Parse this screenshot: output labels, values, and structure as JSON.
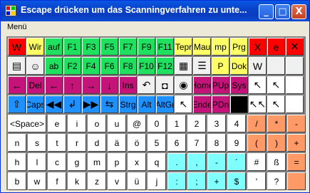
{
  "window": {
    "title": "Escape drücken um das Scanningverfahren zu unte...",
    "min_glyph": "_",
    "max_glyph": "□",
    "close_glyph": "X"
  },
  "menu": {
    "label": "Menü"
  },
  "rows": [
    [
      {
        "t": "",
        "c": "red",
        "icon": "word-icon",
        "g": "W"
      },
      {
        "t": "Wir",
        "c": "yel"
      },
      {
        "t": "auf",
        "c": "grn"
      },
      {
        "t": "F1",
        "c": "grn"
      },
      {
        "t": "F3",
        "c": "grn"
      },
      {
        "t": "F5",
        "c": "grn"
      },
      {
        "t": "F7",
        "c": "grn"
      },
      {
        "t": "F9",
        "c": "grn"
      },
      {
        "t": "F11",
        "c": "grn"
      },
      {
        "t": "Tepr",
        "c": "yel"
      },
      {
        "t": "Mau",
        "c": "yel"
      },
      {
        "t": "mp",
        "c": "yel"
      },
      {
        "t": "Prg",
        "c": "yel"
      },
      {
        "t": "",
        "c": "red",
        "icon": "excel-icon",
        "g": "X"
      },
      {
        "t": "",
        "c": "red",
        "icon": "internet-explorer-icon",
        "g": "e"
      },
      {
        "t": "",
        "c": "red",
        "icon": "close-icon",
        "g": "✕"
      }
    ],
    [
      {
        "t": "",
        "c": "icn",
        "icon": "document-icon",
        "g": "▤"
      },
      {
        "t": "",
        "c": "icn",
        "icon": "contacts-icon",
        "g": "☺"
      },
      {
        "t": "ab",
        "c": "grn"
      },
      {
        "t": "F2",
        "c": "grn"
      },
      {
        "t": "F4",
        "c": "grn"
      },
      {
        "t": "F6",
        "c": "grn"
      },
      {
        "t": "F8",
        "c": "grn"
      },
      {
        "t": "F10",
        "c": "grn"
      },
      {
        "t": "F12",
        "c": "grn"
      },
      {
        "t": "",
        "c": "icn",
        "icon": "keyboard-icon",
        "g": "▦"
      },
      {
        "t": "",
        "c": "icn",
        "icon": "list-icon",
        "g": "☰"
      },
      {
        "t": "P",
        "c": "yel"
      },
      {
        "t": "Dok",
        "c": "yel"
      },
      {
        "t": "",
        "c": "icn",
        "icon": "word-file-icon",
        "g": "W"
      },
      {
        "t": "",
        "c": "icn",
        "icon": "blank-icon",
        "g": ""
      },
      {
        "t": "",
        "c": "icn",
        "icon": "blank-icon",
        "g": ""
      }
    ],
    [
      {
        "t": "",
        "c": "mag",
        "icon": "arrow-left-icon",
        "g": "←"
      },
      {
        "t": "Del",
        "c": "mag"
      },
      {
        "t": "",
        "c": "mag",
        "icon": "arrow-left-icon",
        "g": "←"
      },
      {
        "t": "",
        "c": "mag",
        "icon": "arrow-up-icon",
        "g": "↑"
      },
      {
        "t": "",
        "c": "mag",
        "icon": "arrow-right-icon",
        "g": "→"
      },
      {
        "t": "",
        "c": "mag",
        "icon": "arrow-down-icon",
        "g": "↓"
      },
      {
        "t": "Ins",
        "c": "mag"
      },
      {
        "t": "",
        "c": "icn",
        "icon": "undo-icon",
        "g": "↶"
      },
      {
        "t": "",
        "c": "icn",
        "icon": "camera-icon",
        "g": "◘"
      },
      {
        "t": "",
        "c": "icn",
        "icon": "magnifier-icon",
        "g": "◉"
      },
      {
        "t": "Home",
        "c": "mag"
      },
      {
        "t": "PUp",
        "c": "mag"
      },
      {
        "t": "Sys",
        "c": "mag"
      },
      {
        "t": "",
        "c": "wht",
        "icon": "cursor-icon",
        "g": "↖"
      },
      {
        "t": "",
        "c": "wht",
        "icon": "cursor-icon",
        "g": "↖"
      },
      {
        "t": "",
        "c": "wht",
        "icon": "blank-icon",
        "g": ""
      }
    ],
    [
      {
        "t": "",
        "c": "blu",
        "icon": "shift-icon",
        "g": "⇧"
      },
      {
        "t": "Caps",
        "c": "blu"
      },
      {
        "t": "",
        "c": "blu",
        "icon": "rewind-icon",
        "g": "◀◀"
      },
      {
        "t": "",
        "c": "blu",
        "icon": "arrow-down-return-icon",
        "g": "↲"
      },
      {
        "t": "",
        "c": "blu",
        "icon": "fast-forward-icon",
        "g": "▶▶"
      },
      {
        "t": "",
        "c": "blu",
        "icon": "tab-icon",
        "g": "⇆"
      },
      {
        "t": "Strg",
        "c": "blu"
      },
      {
        "t": "Alt",
        "c": "blu"
      },
      {
        "t": "AltGr",
        "c": "blu"
      },
      {
        "t": "",
        "c": "wht",
        "icon": "cursor-icon",
        "g": "↖"
      },
      {
        "t": "Ende",
        "c": "mag"
      },
      {
        "t": "PDn",
        "c": "mag"
      },
      {
        "t": "",
        "c": "blk",
        "icon": "black-square-icon",
        "g": ""
      },
      {
        "t": "",
        "c": "wht",
        "icon": "double-cursor-icon",
        "g": "↖↖"
      },
      {
        "t": "",
        "c": "wht",
        "icon": "cursor-arrow-icon",
        "g": "↖"
      },
      {
        "t": "",
        "c": "wht",
        "icon": "blank-icon",
        "g": ""
      }
    ],
    [
      {
        "t": "<Space>",
        "c": "wht",
        "w": 2
      },
      {
        "t": "e",
        "c": "wht"
      },
      {
        "t": "i",
        "c": "wht"
      },
      {
        "t": "o",
        "c": "wht"
      },
      {
        "t": "u",
        "c": "wht"
      },
      {
        "t": "@",
        "c": "wht"
      },
      {
        "t": "0",
        "c": "wht"
      },
      {
        "t": "1",
        "c": "wht"
      },
      {
        "t": "2",
        "c": "wht"
      },
      {
        "t": "3",
        "c": "wht"
      },
      {
        "t": "4",
        "c": "wht"
      },
      {
        "t": "/",
        "c": "org"
      },
      {
        "t": "*",
        "c": "org"
      },
      {
        "t": "-",
        "c": "org"
      }
    ],
    [
      {
        "t": "n",
        "c": "wht"
      },
      {
        "t": "s",
        "c": "wht"
      },
      {
        "t": "t",
        "c": "wht"
      },
      {
        "t": "r",
        "c": "wht"
      },
      {
        "t": "d",
        "c": "wht"
      },
      {
        "t": "ä",
        "c": "wht"
      },
      {
        "t": "ö",
        "c": "wht"
      },
      {
        "t": "5",
        "c": "wht"
      },
      {
        "t": "6",
        "c": "wht"
      },
      {
        "t": "7",
        "c": "wht"
      },
      {
        "t": "8",
        "c": "wht"
      },
      {
        "t": "9",
        "c": "wht"
      },
      {
        "t": "(",
        "c": "org"
      },
      {
        "t": ")",
        "c": "org"
      },
      {
        "t": "+",
        "c": "org"
      }
    ],
    [
      {
        "t": "h",
        "c": "wht"
      },
      {
        "t": "l",
        "c": "wht"
      },
      {
        "t": "c",
        "c": "wht"
      },
      {
        "t": "g",
        "c": "wht"
      },
      {
        "t": "m",
        "c": "wht"
      },
      {
        "t": "p",
        "c": "wht"
      },
      {
        "t": "x",
        "c": "wht"
      },
      {
        "t": "q",
        "c": "wht"
      },
      {
        "t": ".",
        "c": "cya"
      },
      {
        "t": ",",
        "c": "cya"
      },
      {
        "t": "-",
        "c": "cya"
      },
      {
        "t": "´",
        "c": "cya"
      },
      {
        "t": "#",
        "c": "wht"
      },
      {
        "t": "ß",
        "c": "wht"
      },
      {
        "t": "=",
        "c": "org"
      }
    ],
    [
      {
        "t": "b",
        "c": "wht"
      },
      {
        "t": "w",
        "c": "wht"
      },
      {
        "t": "f",
        "c": "wht"
      },
      {
        "t": "k",
        "c": "wht"
      },
      {
        "t": "z",
        "c": "wht"
      },
      {
        "t": "v",
        "c": "wht"
      },
      {
        "t": "ü",
        "c": "wht"
      },
      {
        "t": "j",
        "c": "wht"
      },
      {
        "t": ":",
        "c": "cya"
      },
      {
        "t": ";",
        "c": "cya"
      },
      {
        "t": "+",
        "c": "cya"
      },
      {
        "t": "$",
        "c": "cya"
      },
      {
        "t": "'",
        "c": "wht"
      },
      {
        "t": "?",
        "c": "wht"
      },
      {
        "t": "",
        "c": "org",
        "icon": "blank-icon",
        "g": ""
      }
    ]
  ]
}
